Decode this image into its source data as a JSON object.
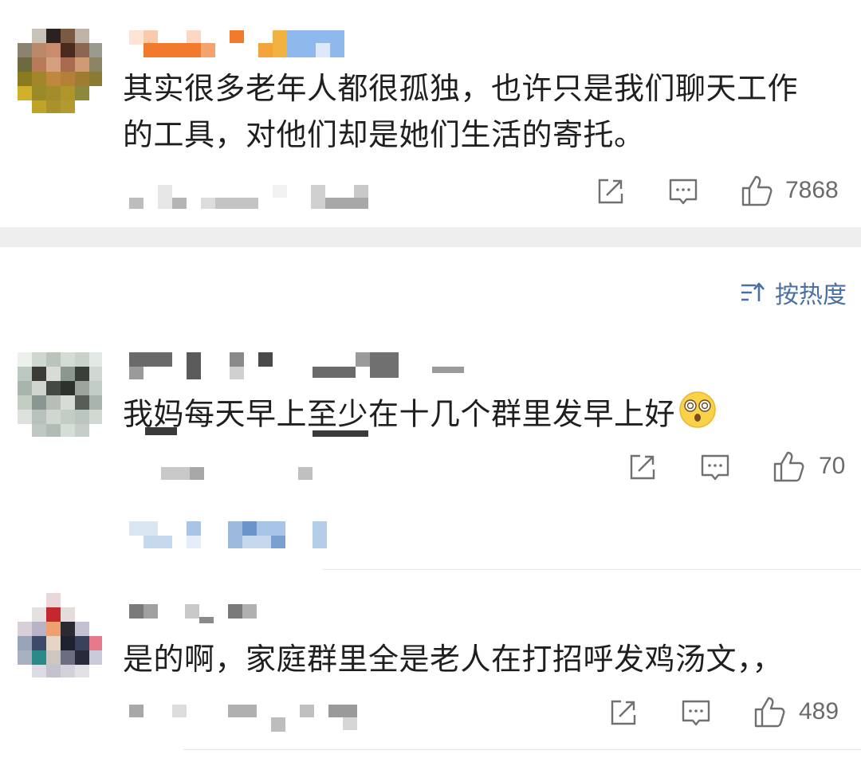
{
  "comments": [
    {
      "text_lines": [
        "其实很多老年人都很孤独，也许只是我们聊天工作",
        "的工具，对他们却是她们生活的寄托。"
      ],
      "likes": "7868"
    },
    {
      "text_lines": [
        "我妈每天早上至少在十几个群里发早上好"
      ],
      "emoji": "dizzy-face-emoji",
      "likes": "70"
    },
    {
      "text_lines": [
        "是的啊，家庭群里全是老人在打招呼发鸡汤文，，"
      ],
      "likes": "489"
    }
  ],
  "sort": {
    "label": "按热度",
    "icon": "sort-icon"
  },
  "icons": {
    "share": "share-icon",
    "reply": "comment-icon",
    "like": "thumbs-up-icon"
  },
  "colors": {
    "text": "#1f1f1f",
    "meta": "#6b6b6b",
    "accent": "#4a6fa5",
    "separator": "#eeeeee"
  }
}
